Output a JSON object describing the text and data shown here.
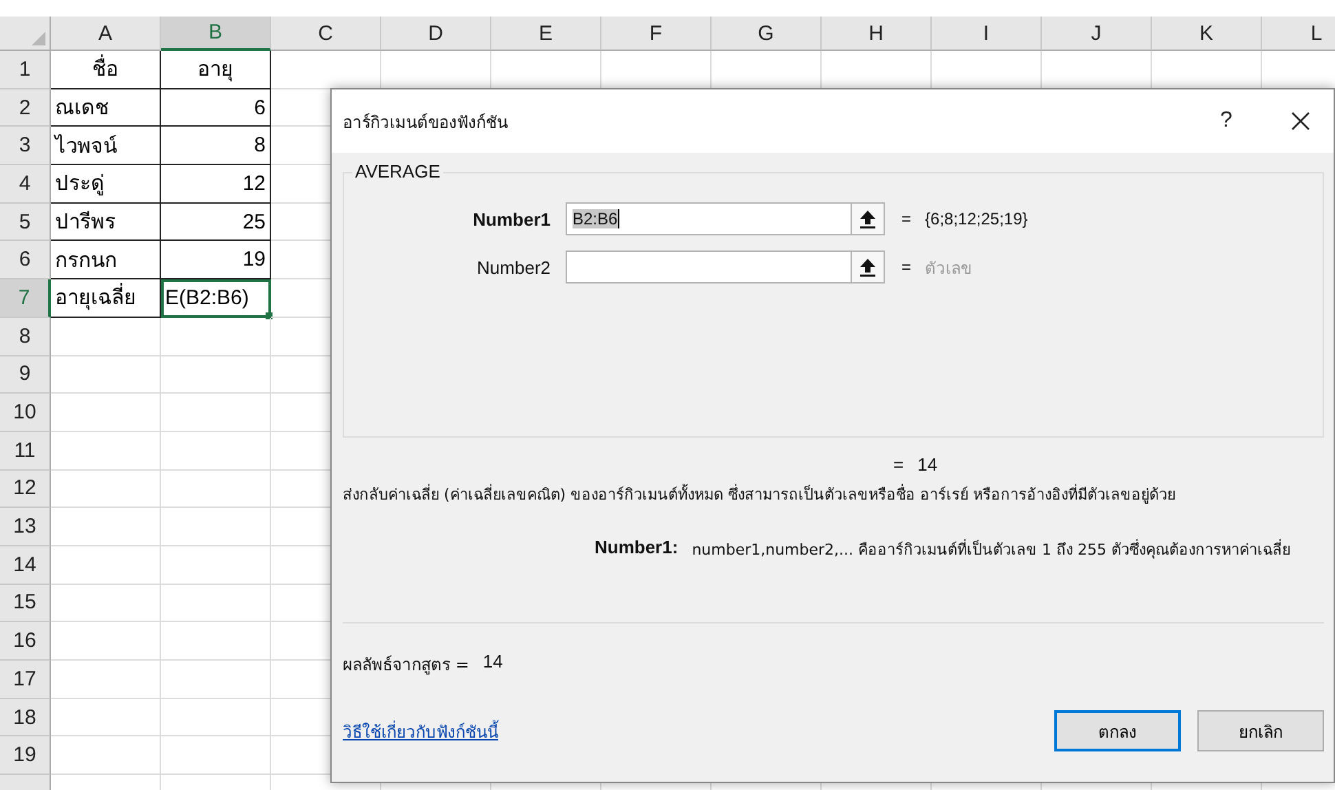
{
  "sheet": {
    "columns": [
      {
        "label": "A",
        "selected": false
      },
      {
        "label": "B",
        "selected": true
      },
      {
        "label": "C",
        "selected": false
      },
      {
        "label": "D",
        "selected": false
      },
      {
        "label": "E",
        "selected": false
      },
      {
        "label": "F",
        "selected": false
      },
      {
        "label": "G",
        "selected": false
      },
      {
        "label": "H",
        "selected": false
      },
      {
        "label": "I",
        "selected": false
      },
      {
        "label": "J",
        "selected": false
      },
      {
        "label": "K",
        "selected": false
      },
      {
        "label": "L",
        "selected": false
      }
    ],
    "rows": [
      {
        "label": "1",
        "selected": false,
        "cells": [
          {
            "text": "ชื่อ",
            "kind": "heading",
            "selected": false
          },
          {
            "text": "อายุ",
            "kind": "heading",
            "selected": false
          }
        ]
      },
      {
        "label": "2",
        "selected": false,
        "cells": [
          {
            "text": "ณเดช",
            "kind": "text",
            "selected": false
          },
          {
            "text": "6",
            "kind": "number",
            "selected": false
          }
        ]
      },
      {
        "label": "3",
        "selected": false,
        "cells": [
          {
            "text": "ไวพจน์",
            "kind": "text",
            "selected": false
          },
          {
            "text": "8",
            "kind": "number",
            "selected": false
          }
        ]
      },
      {
        "label": "4",
        "selected": false,
        "cells": [
          {
            "text": "ประดู่",
            "kind": "text",
            "selected": false
          },
          {
            "text": "12",
            "kind": "number",
            "selected": false
          }
        ]
      },
      {
        "label": "5",
        "selected": false,
        "cells": [
          {
            "text": "ปารีพร",
            "kind": "text",
            "selected": false
          },
          {
            "text": "25",
            "kind": "number",
            "selected": false
          }
        ]
      },
      {
        "label": "6",
        "selected": false,
        "cells": [
          {
            "text": "กรกนก",
            "kind": "text",
            "selected": false
          },
          {
            "text": "19",
            "kind": "number",
            "selected": false
          }
        ]
      },
      {
        "label": "7",
        "selected": true,
        "cells": [
          {
            "text": "อายุเฉลี่ย",
            "kind": "text",
            "selected": false
          },
          {
            "text": "E(B2:B6)",
            "kind": "text",
            "selected": true
          }
        ]
      },
      {
        "label": "8",
        "selected": false
      },
      {
        "label": "9",
        "selected": false
      },
      {
        "label": "10",
        "selected": false
      },
      {
        "label": "11",
        "selected": false
      },
      {
        "label": "12",
        "selected": false
      },
      {
        "label": "13",
        "selected": false
      },
      {
        "label": "14",
        "selected": false
      },
      {
        "label": "15",
        "selected": false
      },
      {
        "label": "16",
        "selected": false
      },
      {
        "label": "17",
        "selected": false
      },
      {
        "label": "18",
        "selected": false
      },
      {
        "label": "19",
        "selected": false
      }
    ]
  },
  "dialog": {
    "title": "อาร์กิวเมนต์ของฟังก์ชัน",
    "help_button": "?",
    "function_name": "AVERAGE",
    "arguments": [
      {
        "label": "Number1",
        "active": true,
        "value": "B2:B6",
        "sign": "=",
        "result": "{6;8;12;25;19}",
        "result_greyed": false
      },
      {
        "label": "Number2",
        "active": false,
        "sign": "=",
        "result": "ตัวเลข",
        "result_greyed": true
      }
    ],
    "result": {
      "sign": "=",
      "value": "14"
    },
    "description": "ส่งกลับค่าเฉลี่ย (ค่าเฉลี่ยเลขคณิต) ของอาร์กิวเมนต์ทั้งหมด ซึ่งสามารถเป็นตัวเลขหรือชื่อ อาร์เรย์ หรือการอ้างอิงที่มีตัวเลขอยู่ด้วย",
    "argument_help": {
      "label": "Number1:",
      "text": "number1,number2,... คืออาร์กิวเมนต์ที่เป็นตัวเลข 1 ถึง 255 ตัวซึ่งคุณต้องการหาค่าเฉลี่ย"
    },
    "formula_result": {
      "label": "ผลลัพธ์จากสูตร =",
      "value": "14"
    },
    "help_link": "วิธีใช้เกี่ยวกับฟังก์ชันนี้",
    "buttons": [
      {
        "label": "ตกลง",
        "default": true
      },
      {
        "label": "ยกเลิก",
        "default": false
      }
    ]
  }
}
